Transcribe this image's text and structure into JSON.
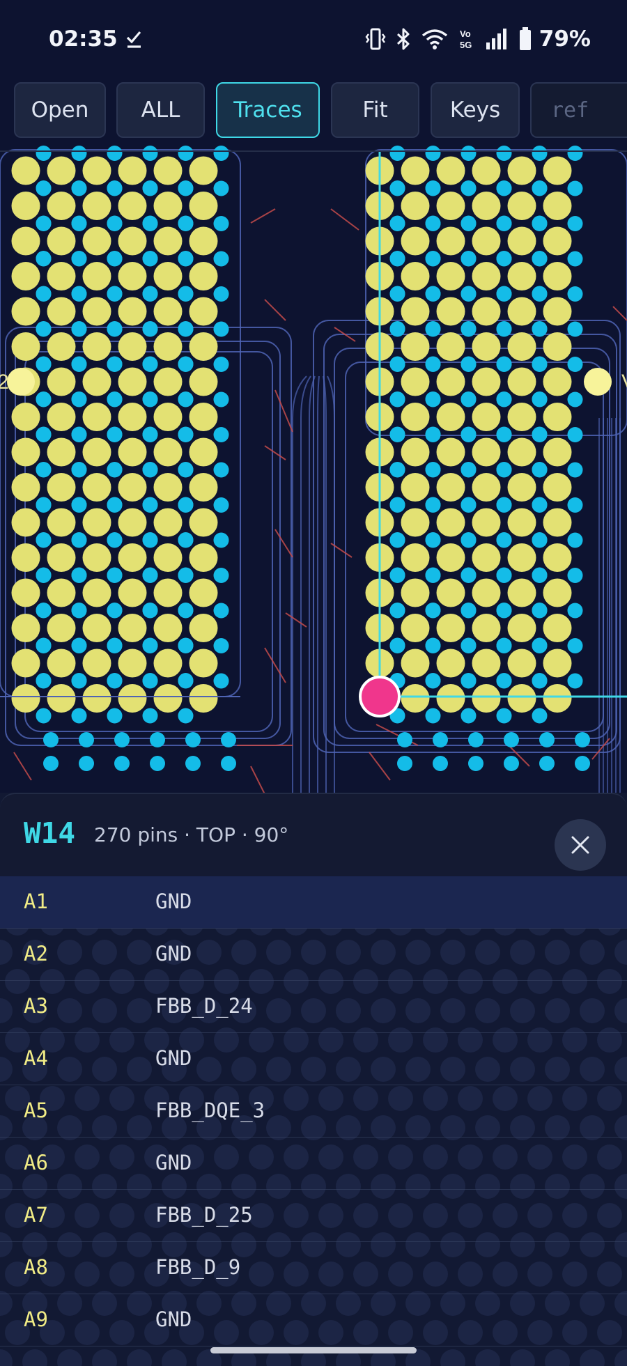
{
  "status_bar": {
    "time": "02:35",
    "battery": "79%",
    "icons": [
      "check-icon",
      "vibrate-icon",
      "bluetooth-icon",
      "wifi-icon",
      "volte-icon",
      "signal-icon",
      "battery-icon"
    ]
  },
  "toolbar": {
    "buttons": [
      {
        "label": "Open"
      },
      {
        "label": "ALL"
      },
      {
        "label": "Traces"
      },
      {
        "label": "Fit"
      },
      {
        "label": "Keys"
      }
    ],
    "active": "Traces",
    "ref_placeholder": "ref"
  },
  "board": {
    "colors": {
      "background": "#0d1330",
      "pad_large": "#e3e173",
      "pad_small": "#14bce8",
      "selected_pin": "#f0368c",
      "crosshair": "#3fd8e6",
      "outline": "#4f64b4",
      "trace": "#c44b4b"
    },
    "edge_labels": {
      "left": "2",
      "right": "V"
    }
  },
  "panel": {
    "component": "W14",
    "meta": "270 pins · TOP · 90°",
    "close_icon": "close-icon",
    "pins": [
      {
        "pin": "A1",
        "net": "GND",
        "selected": true
      },
      {
        "pin": "A2",
        "net": "GND"
      },
      {
        "pin": "A3",
        "net": "FBB_D_24"
      },
      {
        "pin": "A4",
        "net": "GND"
      },
      {
        "pin": "A5",
        "net": "FBB_DQE_3"
      },
      {
        "pin": "A6",
        "net": "GND"
      },
      {
        "pin": "A7",
        "net": "FBB_D_25"
      },
      {
        "pin": "A8",
        "net": "FBB_D_9"
      },
      {
        "pin": "A9",
        "net": "GND"
      }
    ]
  }
}
